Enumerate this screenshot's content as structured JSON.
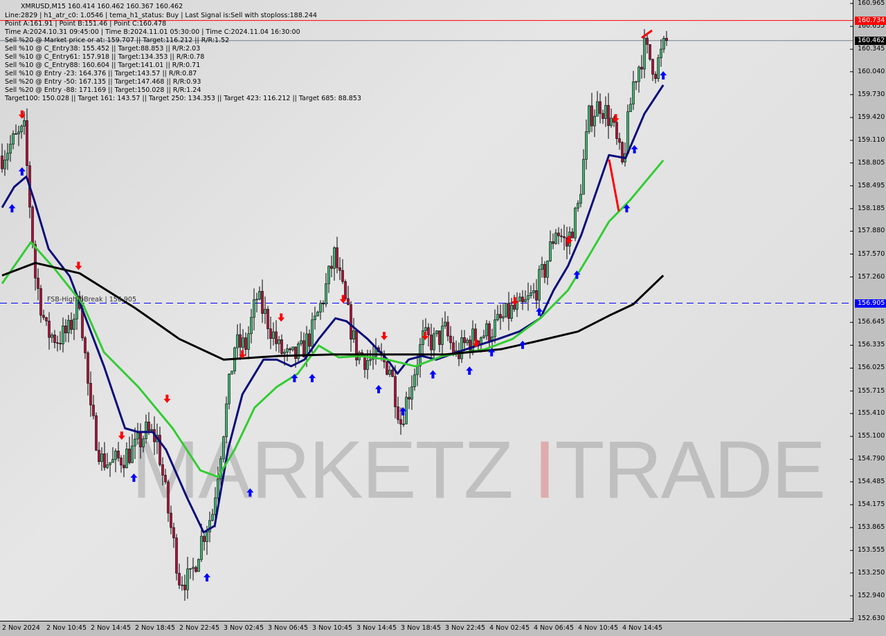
{
  "header": {
    "symbol_line": "XMRUSD,M15  160.414 160.462 160.367 160.462",
    "lines": [
      "Line:2829 | h1_atr_c0: 1.0546 | tema_h1_status: Buy | Last Signal is:Sell with stoploss:188.244",
      "Point A:161.91 | Point B:151.46 | Point C:160.478",
      "Time A:2024.10.31 09:45:00 | Time B:2024.11.01 05:30:00 | Time C:2024.11.04 16:30:00",
      "Sell %20 @ Market price or at: 159.707 || Target:116.212 || R/R:1.52",
      "Sell %10 @ C_Entry38: 155.452 || Target:88.853 || R/R:2.03",
      "Sell %10 @ C_Entry61: 157.918 || Target:134.353 || R/R:0.78",
      "Sell %10 @ C_Entry88: 160.604 || Target:141.01 || R/R:0.71",
      "Sell %10 @ Entry -23: 164.376 || Target:143.57 || R/R:0.87",
      "Sell %20 @ Entry -50: 167.135 || Target:147.468 || R/R:0.93",
      "Sell %20 @ Entry -88: 171.169 || Target:150.028 || R/R:1.24",
      "Target100: 150.028 || Target 161: 143.57 || Target 250: 134.353 || Target 423: 116.212 || Target 685: 88.853"
    ]
  },
  "watermark": {
    "text1": "MARKETZ",
    "text2": "TRADE"
  },
  "fsb_label": "FSB-HighToBreak | 156.905",
  "colors": {
    "bull": "#3cb371",
    "bear": "#b0103a",
    "tema": "#0a0a7a",
    "ma_green": "#33cc33",
    "ma_black": "#000000",
    "stop_line": "#ff0000",
    "fsb_line": "#0000cc"
  },
  "chart_data": {
    "type": "candlestick",
    "symbol": "XMRUSD",
    "timeframe": "M15",
    "ylim": [
      152.63,
      160.965
    ],
    "y_ticks": [
      "160.965",
      "160.655",
      "160.345",
      "160.040",
      "159.730",
      "159.420",
      "159.110",
      "158.805",
      "158.495",
      "158.185",
      "157.880",
      "157.570",
      "157.260",
      "156.645",
      "156.335",
      "156.025",
      "155.715",
      "155.410",
      "155.100",
      "154.790",
      "154.485",
      "154.175",
      "153.865",
      "153.555",
      "153.250",
      "152.940",
      "152.630"
    ],
    "x_ticks": [
      "2 Nov 2024",
      "2 Nov 10:45",
      "2 Nov 14:45",
      "2 Nov 18:45",
      "2 Nov 22:45",
      "3 Nov 02:45",
      "3 Nov 06:45",
      "3 Nov 10:45",
      "3 Nov 14:45",
      "3 Nov 18:45",
      "3 Nov 22:45",
      "4 Nov 02:45",
      "4 Nov 06:45",
      "4 Nov 10:45",
      "4 Nov 14:45"
    ],
    "hourly_closes": [
      158.9,
      159.09,
      159.23,
      157.27,
      156.52,
      156.42,
      156.52,
      156.98,
      155.39,
      154.78,
      154.74,
      154.83,
      154.93,
      155.16,
      155.07,
      154.08,
      153.19,
      153.15,
      153.71,
      154.08,
      155.21,
      156.33,
      156.33,
      156.98,
      156.66,
      156.28,
      156.14,
      156.24,
      156.52,
      156.98,
      157.55,
      156.89,
      156.24,
      156.14,
      156.14,
      156.05,
      155.3,
      155.86,
      156.42,
      156.38,
      156.52,
      156.19,
      156.38,
      156.47,
      156.52,
      156.66,
      156.8,
      156.84,
      157.03,
      157.36,
      157.92,
      157.69,
      158.2,
      159.42,
      159.61,
      159.37,
      158.76,
      159.89,
      160.36,
      160.08,
      160.462
    ],
    "series": [
      {
        "key": "tema",
        "points": [
          [
            0,
            158.2
          ],
          [
            1.1,
            158.48
          ],
          [
            2.2,
            158.62
          ],
          [
            2.9,
            158.3
          ],
          [
            4.2,
            157.64
          ],
          [
            6.1,
            157.27
          ],
          [
            7.3,
            156.8
          ],
          [
            9.2,
            156.05
          ],
          [
            11.1,
            155.21
          ],
          [
            12.3,
            155.16
          ],
          [
            13.6,
            155.16
          ],
          [
            14.8,
            154.92
          ],
          [
            16.7,
            154.27
          ],
          [
            18.2,
            153.8
          ],
          [
            19.2,
            153.89
          ],
          [
            20.4,
            154.92
          ],
          [
            21.7,
            155.67
          ],
          [
            23.6,
            156.14
          ],
          [
            24.8,
            156.14
          ],
          [
            26.1,
            156.05
          ],
          [
            27.3,
            156.14
          ],
          [
            28.6,
            156.42
          ],
          [
            30.1,
            156.7
          ],
          [
            31.1,
            156.66
          ],
          [
            33,
            156.42
          ],
          [
            34.8,
            156.14
          ],
          [
            35.7,
            155.95
          ],
          [
            36.7,
            156.14
          ],
          [
            37.9,
            156.19
          ],
          [
            39.2,
            156.14
          ],
          [
            41.1,
            156.24
          ],
          [
            42.9,
            156.33
          ],
          [
            44.8,
            156.42
          ],
          [
            46.7,
            156.52
          ],
          [
            48.6,
            156.7
          ],
          [
            49.8,
            157.08
          ],
          [
            51.1,
            157.41
          ],
          [
            52.3,
            157.83
          ],
          [
            53.6,
            158.39
          ],
          [
            54.8,
            158.91
          ],
          [
            56.3,
            158.87
          ],
          [
            58,
            159.47
          ],
          [
            59.7,
            159.86
          ]
        ]
      },
      {
        "key": "ma_green",
        "points": [
          [
            0,
            157.17
          ],
          [
            2.6,
            157.73
          ],
          [
            4.8,
            157.36
          ],
          [
            7.3,
            156.89
          ],
          [
            9.2,
            156.24
          ],
          [
            12.3,
            155.77
          ],
          [
            15.4,
            155.21
          ],
          [
            17.9,
            154.64
          ],
          [
            19.5,
            154.55
          ],
          [
            21,
            154.92
          ],
          [
            22.8,
            155.49
          ],
          [
            24.8,
            155.77
          ],
          [
            26.7,
            155.95
          ],
          [
            28.6,
            156.33
          ],
          [
            30.4,
            156.17
          ],
          [
            32.3,
            156.19
          ],
          [
            34.8,
            156.14
          ],
          [
            37.3,
            156.05
          ],
          [
            39.8,
            156.19
          ],
          [
            43.6,
            156.28
          ],
          [
            46.1,
            156.42
          ],
          [
            48.6,
            156.7
          ],
          [
            51.1,
            157.08
          ],
          [
            53,
            157.55
          ],
          [
            54.8,
            158.01
          ],
          [
            56.7,
            158.3
          ],
          [
            59.7,
            158.84
          ]
        ]
      },
      {
        "key": "ma_black",
        "points": [
          [
            0,
            157.28
          ],
          [
            3,
            157.45
          ],
          [
            7,
            157.31
          ],
          [
            12,
            156.84
          ],
          [
            16,
            156.42
          ],
          [
            20,
            156.14
          ],
          [
            25,
            156.19
          ],
          [
            30,
            156.21
          ],
          [
            40,
            156.21
          ],
          [
            45,
            156.28
          ],
          [
            48,
            156.38
          ],
          [
            52,
            156.52
          ],
          [
            55,
            156.75
          ],
          [
            57,
            156.89
          ],
          [
            59.7,
            157.28
          ]
        ]
      }
    ],
    "levels": [
      {
        "name": "stoploss",
        "price": "160.734",
        "color": "#ff0000",
        "style": "solid"
      },
      {
        "name": "last",
        "price": "160.462",
        "color": "#000000",
        "style": "solid"
      },
      {
        "name": "fsb",
        "price": "156.905",
        "color": "#0000ff",
        "style": "dashed"
      }
    ],
    "signals": [
      {
        "type": "sell",
        "hour": 1.8,
        "price": 159.45
      },
      {
        "type": "sell",
        "hour": 6.9,
        "price": 157.4
      },
      {
        "type": "sell",
        "hour": 10.8,
        "price": 155.1
      },
      {
        "type": "sell",
        "hour": 14.9,
        "price": 155.6
      },
      {
        "type": "sell",
        "hour": 21.7,
        "price": 156.2
      },
      {
        "type": "sell",
        "hour": 25.2,
        "price": 156.7
      },
      {
        "type": "sell",
        "hour": 30.8,
        "price": 156.95
      },
      {
        "type": "sell",
        "hour": 34.5,
        "price": 156.45
      },
      {
        "type": "sell",
        "hour": 38.2,
        "price": 156.45
      },
      {
        "type": "sell",
        "hour": 42.8,
        "price": 156.35
      },
      {
        "type": "sell",
        "hour": 46.3,
        "price": 156.92
      },
      {
        "type": "sell",
        "hour": 51.2,
        "price": 157.75
      },
      {
        "type": "sell",
        "hour": 55.4,
        "price": 159.4
      },
      {
        "type": "buy",
        "hour": 0.9,
        "price": 158.2
      },
      {
        "type": "buy",
        "hour": 1.8,
        "price": 158.7
      },
      {
        "type": "buy",
        "hour": 11.9,
        "price": 154.55
      },
      {
        "type": "buy",
        "hour": 18.5,
        "price": 153.2
      },
      {
        "type": "buy",
        "hour": 22.4,
        "price": 154.35
      },
      {
        "type": "buy",
        "hour": 26.4,
        "price": 155.9
      },
      {
        "type": "buy",
        "hour": 28.0,
        "price": 155.9
      },
      {
        "type": "buy",
        "hour": 34.0,
        "price": 155.75
      },
      {
        "type": "buy",
        "hour": 36.2,
        "price": 155.45
      },
      {
        "type": "buy",
        "hour": 38.9,
        "price": 155.95
      },
      {
        "type": "buy",
        "hour": 42.2,
        "price": 156.0
      },
      {
        "type": "buy",
        "hour": 44.2,
        "price": 156.25
      },
      {
        "type": "buy",
        "hour": 47.0,
        "price": 156.35
      },
      {
        "type": "buy",
        "hour": 48.5,
        "price": 156.8
      },
      {
        "type": "buy",
        "hour": 51.9,
        "price": 157.3
      },
      {
        "type": "buy",
        "hour": 56.4,
        "price": 158.2
      },
      {
        "type": "buy",
        "hour": 57.1,
        "price": 159.0
      },
      {
        "type": "buy",
        "hour": 59.7,
        "price": 160.0
      }
    ]
  }
}
